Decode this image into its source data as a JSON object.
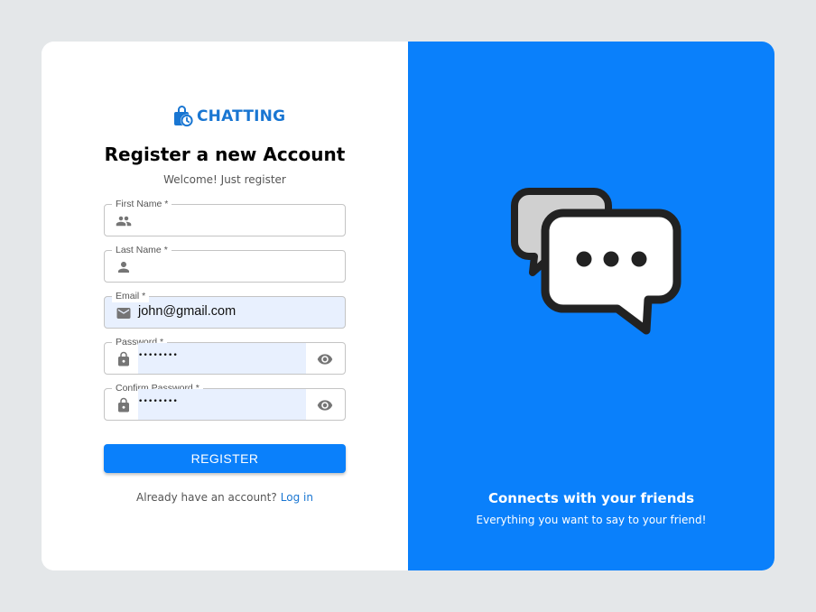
{
  "brand": {
    "name": "CHATTING",
    "icon": "shopping-bag-clock-icon"
  },
  "form": {
    "title": "Register a new Account",
    "subtitle": "Welcome! Just register",
    "fields": {
      "first_name": {
        "label": "First Name *",
        "value": "",
        "icon": "people-icon"
      },
      "last_name": {
        "label": "Last Name *",
        "value": "",
        "icon": "person-icon"
      },
      "email": {
        "label": "Email *",
        "value": "john@gmail.com",
        "icon": "mail-icon"
      },
      "password": {
        "label": "Password *",
        "value": "••••••••",
        "icon": "lock-icon",
        "toggle_icon": "eye-icon"
      },
      "confirm_password": {
        "label": "Confirm Password *",
        "value": "••••••••",
        "icon": "lock-icon",
        "toggle_icon": "eye-icon"
      }
    },
    "submit_label": "REGISTER",
    "login_prompt": "Already have an account?",
    "login_link": "Log in"
  },
  "promo": {
    "title": "Connects with your friends",
    "subtitle": "Everything you want to say to your friend!",
    "illustration": "chat-bubbles-icon"
  },
  "colors": {
    "primary": "#0a80fb",
    "brand_text": "#1976d2",
    "page_background": "#e4e7e9",
    "autofill": "#e8f0fe"
  }
}
